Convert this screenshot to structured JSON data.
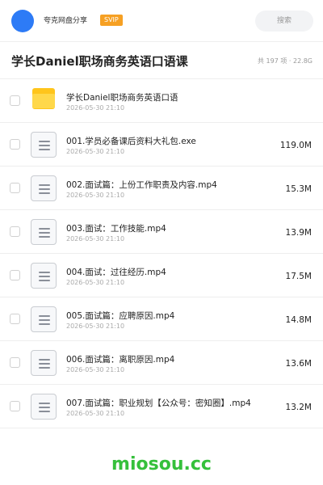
{
  "header": {
    "app_name": "夸克网盘分享",
    "badge": "SVIP",
    "search_label": "搜索"
  },
  "folder": {
    "title": "学长Daniel职场商务英语口语课",
    "meta": "共 197 项 · 22.8G"
  },
  "files": [
    {
      "type": "folder",
      "name": "学长Daniel职场商务英语口语",
      "date": "2026-05-30 21:10",
      "size": ""
    },
    {
      "type": "file",
      "name": "001.学员必备课后资料大礼包.exe",
      "date": "2026-05-30 21:10",
      "size": "119.0M"
    },
    {
      "type": "file",
      "name": "002.面试篇：上份工作职责及内容.mp4",
      "date": "2026-05-30 21:10",
      "size": "15.3M"
    },
    {
      "type": "file",
      "name": "003.面试：工作技能.mp4",
      "date": "2026-05-30 21:10",
      "size": "13.9M"
    },
    {
      "type": "file",
      "name": "004.面试：过往经历.mp4",
      "date": "2026-05-30 21:10",
      "size": "17.5M"
    },
    {
      "type": "file",
      "name": "005.面试篇：应聘原因.mp4",
      "date": "2026-05-30 21:10",
      "size": "14.8M"
    },
    {
      "type": "file",
      "name": "006.面试篇：离职原因.mp4",
      "date": "2026-05-30 21:10",
      "size": "13.6M"
    },
    {
      "type": "file",
      "name": "007.面试篇：职业规划【公众号：密知圈】.mp4",
      "date": "2026-05-30 21:10",
      "size": "13.2M"
    }
  ],
  "watermark": "miosou.cc",
  "colors": {
    "accent": "#2d7bf6",
    "svip": "#f6a023",
    "folder": "#ffc51b",
    "watermark": "#35c03b"
  }
}
